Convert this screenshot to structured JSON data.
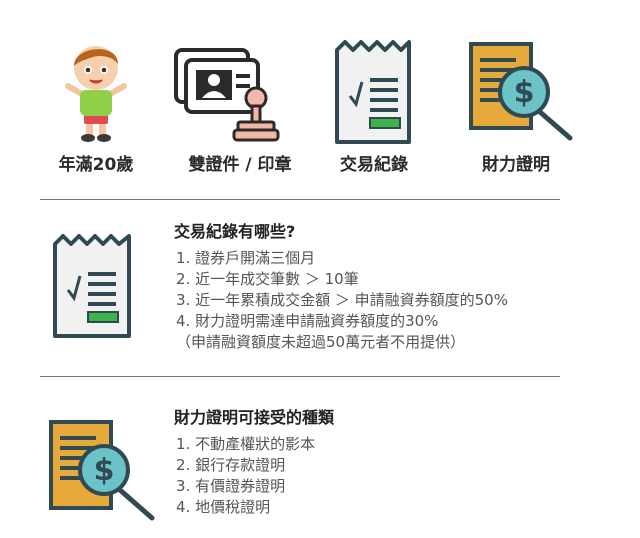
{
  "top_items": [
    {
      "icon": "child-icon",
      "label": "年滿20歲"
    },
    {
      "icon": "id-card-stamp-icon",
      "label": "雙證件 / 印章"
    },
    {
      "icon": "receipt-icon",
      "label": "交易紀錄"
    },
    {
      "icon": "financial-proof-icon",
      "label": "財力證明"
    }
  ],
  "section_transactions": {
    "title": "交易紀錄有哪些?",
    "items": [
      "1. 證券戶開滿三個月",
      "2. 近一年成交筆數 ＞ 10筆",
      "3. 近一年累積成交金額 ＞ 申請融資券額度的50%",
      "4. 財力證明需達申請融資券額度的30%",
      "（申請融資額度未超過50萬元者不用提供）"
    ]
  },
  "section_financial": {
    "title": "財力證明可接受的種類",
    "items": [
      "1. 不動產權狀的影本",
      "2. 銀行存款證明",
      "3. 有價證券證明",
      "4. 地價稅證明"
    ]
  },
  "colors": {
    "dark_teal": "#2f4a52",
    "teal": "#6cc3c7",
    "gold": "#e6a93a",
    "green": "#3fb24a",
    "paper": "#f1f1f1",
    "stamp_pink": "#f3b7a8"
  }
}
